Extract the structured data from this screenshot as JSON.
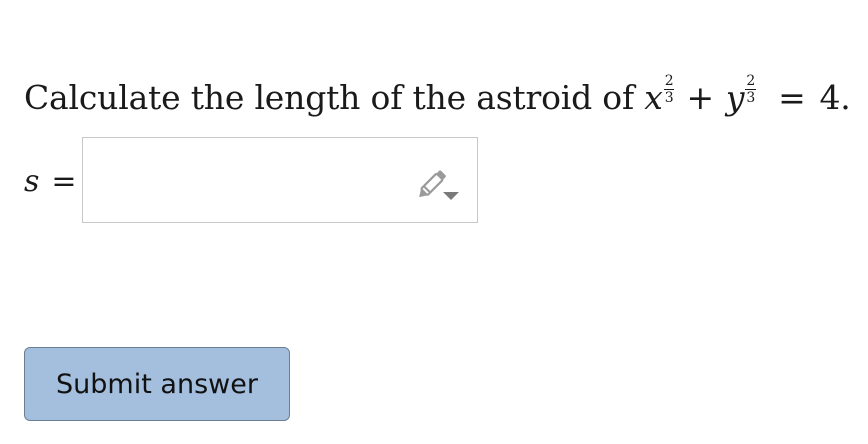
{
  "question": {
    "text": "Calculate the length of the astroid of",
    "var_x": "x",
    "var_y": "y",
    "exp_num": "2",
    "exp_den": "3",
    "plus": "+",
    "equals": "=",
    "rhs": "4."
  },
  "answer": {
    "label_var": "s",
    "label_eq": "=",
    "value": "",
    "input_icon": "pencil-dropdown-icon"
  },
  "submit": {
    "label": "Submit answer",
    "color": "#a3bfdd"
  }
}
